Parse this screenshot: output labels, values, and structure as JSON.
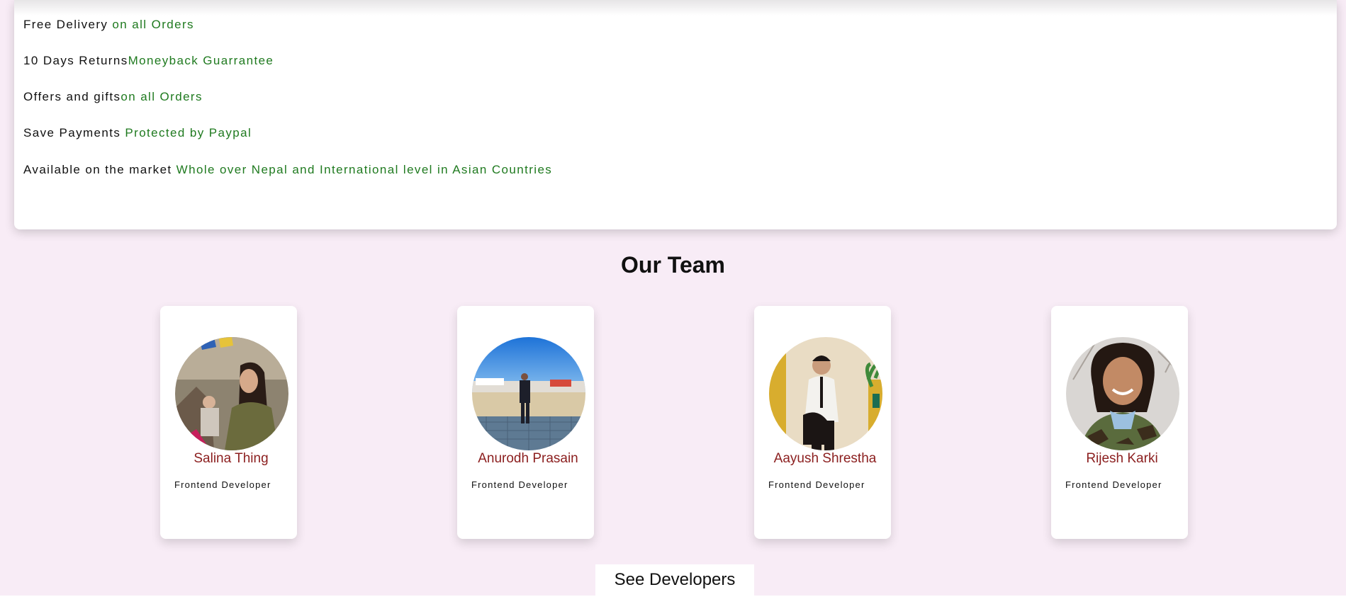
{
  "features": [
    {
      "label": "Free Delivery ",
      "highlight": "on all Orders"
    },
    {
      "label": "10 Days Returns",
      "highlight": "Moneyback Guarrantee"
    },
    {
      "label": "Offers and gifts",
      "highlight": "on all Orders"
    },
    {
      "label": "Save Payments ",
      "highlight": "Protected by Paypal"
    },
    {
      "label": "Available on the market ",
      "highlight": "Whole over Nepal and International level in Asian Countries"
    }
  ],
  "team": {
    "title": "Our Team",
    "members": [
      {
        "name": "Salina Thing",
        "role": "Frontend Developer"
      },
      {
        "name": "Anurodh Prasain",
        "role": "Frontend Developer"
      },
      {
        "name": "Aayush Shrestha",
        "role": "Frontend Developer"
      },
      {
        "name": "Rijesh Karki",
        "role": "Frontend Developer"
      }
    ],
    "button_label": "See Developers"
  },
  "colors": {
    "page_background": "#f8ecf6",
    "highlight_text": "#1f7a1f",
    "member_name": "#8b1e1e"
  }
}
